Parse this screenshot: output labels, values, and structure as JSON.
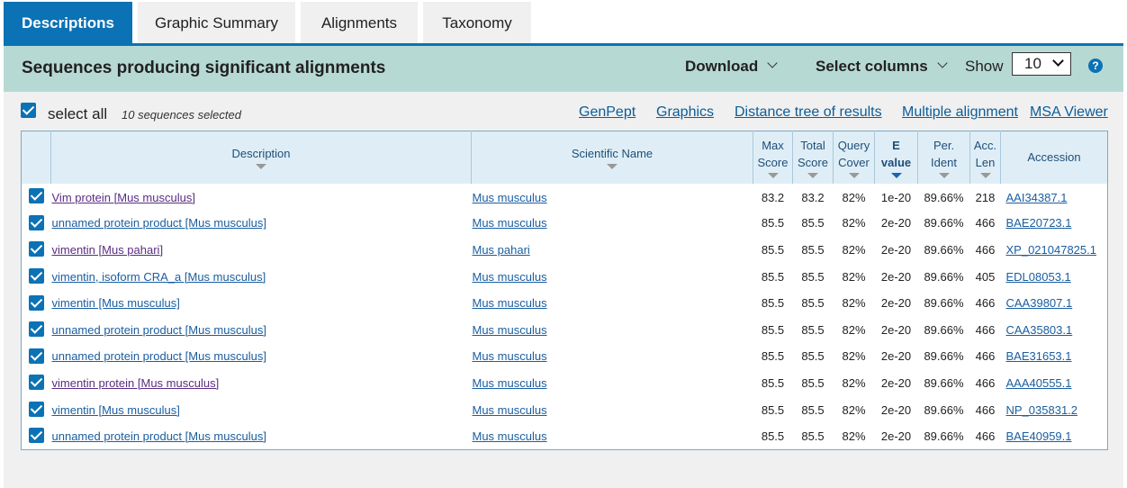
{
  "tabs": [
    {
      "label": "Descriptions",
      "active": true
    },
    {
      "label": "Graphic Summary",
      "active": false
    },
    {
      "label": "Alignments",
      "active": false
    },
    {
      "label": "Taxonomy",
      "active": false
    }
  ],
  "bar": {
    "title": "Sequences producing significant alignments",
    "download": "Download",
    "select_columns": "Select columns",
    "show_label": "Show",
    "show_value": "10",
    "help": "?"
  },
  "selection": {
    "select_all": "select all",
    "count": "10 sequences selected"
  },
  "links": {
    "genpept": "GenPept",
    "graphics": "Graphics",
    "distance_tree": "Distance tree of results",
    "multiple_alignment": "Multiple alignment",
    "msa_viewer": "MSA Viewer"
  },
  "columns": {
    "description": "Description",
    "scientific_name": "Scientific Name",
    "max_score_1": "Max",
    "max_score_2": "Score",
    "total_score_1": "Total",
    "total_score_2": "Score",
    "query_cover_1": "Query",
    "query_cover_2": "Cover",
    "evalue_1": "E",
    "evalue_2": "value",
    "per_ident_1": "Per.",
    "per_ident_2": "Ident",
    "acc_len_1": "Acc.",
    "acc_len_2": "Len",
    "accession": "Accession"
  },
  "rows": [
    {
      "description": "Vim protein [Mus musculus]",
      "visited": true,
      "sci": "Mus musculus",
      "max": "83.2",
      "total": "83.2",
      "cover": "82%",
      "evalue": "1e-20",
      "ident": "89.66%",
      "len": "218",
      "acc": "AAI34387.1"
    },
    {
      "description": "unnamed protein product [Mus musculus]",
      "visited": false,
      "sci": "Mus musculus",
      "max": "85.5",
      "total": "85.5",
      "cover": "82%",
      "evalue": "2e-20",
      "ident": "89.66%",
      "len": "466",
      "acc": "BAE20723.1"
    },
    {
      "description": "vimentin [Mus pahari]",
      "visited": true,
      "sci": "Mus pahari",
      "max": "85.5",
      "total": "85.5",
      "cover": "82%",
      "evalue": "2e-20",
      "ident": "89.66%",
      "len": "466",
      "acc": "XP_021047825.1"
    },
    {
      "description": "vimentin, isoform CRA_a [Mus musculus]",
      "visited": false,
      "sci": "Mus musculus",
      "max": "85.5",
      "total": "85.5",
      "cover": "82%",
      "evalue": "2e-20",
      "ident": "89.66%",
      "len": "405",
      "acc": "EDL08053.1"
    },
    {
      "description": "vimentin [Mus musculus]",
      "visited": false,
      "sci": "Mus musculus",
      "max": "85.5",
      "total": "85.5",
      "cover": "82%",
      "evalue": "2e-20",
      "ident": "89.66%",
      "len": "466",
      "acc": "CAA39807.1"
    },
    {
      "description": "unnamed protein product [Mus musculus]",
      "visited": false,
      "sci": "Mus musculus",
      "max": "85.5",
      "total": "85.5",
      "cover": "82%",
      "evalue": "2e-20",
      "ident": "89.66%",
      "len": "466",
      "acc": "CAA35803.1"
    },
    {
      "description": "unnamed protein product [Mus musculus]",
      "visited": false,
      "sci": "Mus musculus",
      "max": "85.5",
      "total": "85.5",
      "cover": "82%",
      "evalue": "2e-20",
      "ident": "89.66%",
      "len": "466",
      "acc": "BAE31653.1"
    },
    {
      "description": "vimentin protein [Mus musculus]",
      "visited": true,
      "sci": "Mus musculus",
      "max": "85.5",
      "total": "85.5",
      "cover": "82%",
      "evalue": "2e-20",
      "ident": "89.66%",
      "len": "466",
      "acc": "AAA40555.1"
    },
    {
      "description": "vimentin [Mus musculus]",
      "visited": false,
      "sci": "Mus musculus",
      "max": "85.5",
      "total": "85.5",
      "cover": "82%",
      "evalue": "2e-20",
      "ident": "89.66%",
      "len": "466",
      "acc": "NP_035831.2"
    },
    {
      "description": "unnamed protein product [Mus musculus]",
      "visited": false,
      "sci": "Mus musculus",
      "max": "85.5",
      "total": "85.5",
      "cover": "82%",
      "evalue": "2e-20",
      "ident": "89.66%",
      "len": "466",
      "acc": "BAE40959.1"
    }
  ],
  "colors": {
    "accent": "#0b72b5",
    "header_band": "#b7d9d4",
    "link": "#1a5ea0",
    "visited_link": "#5a2d82"
  }
}
